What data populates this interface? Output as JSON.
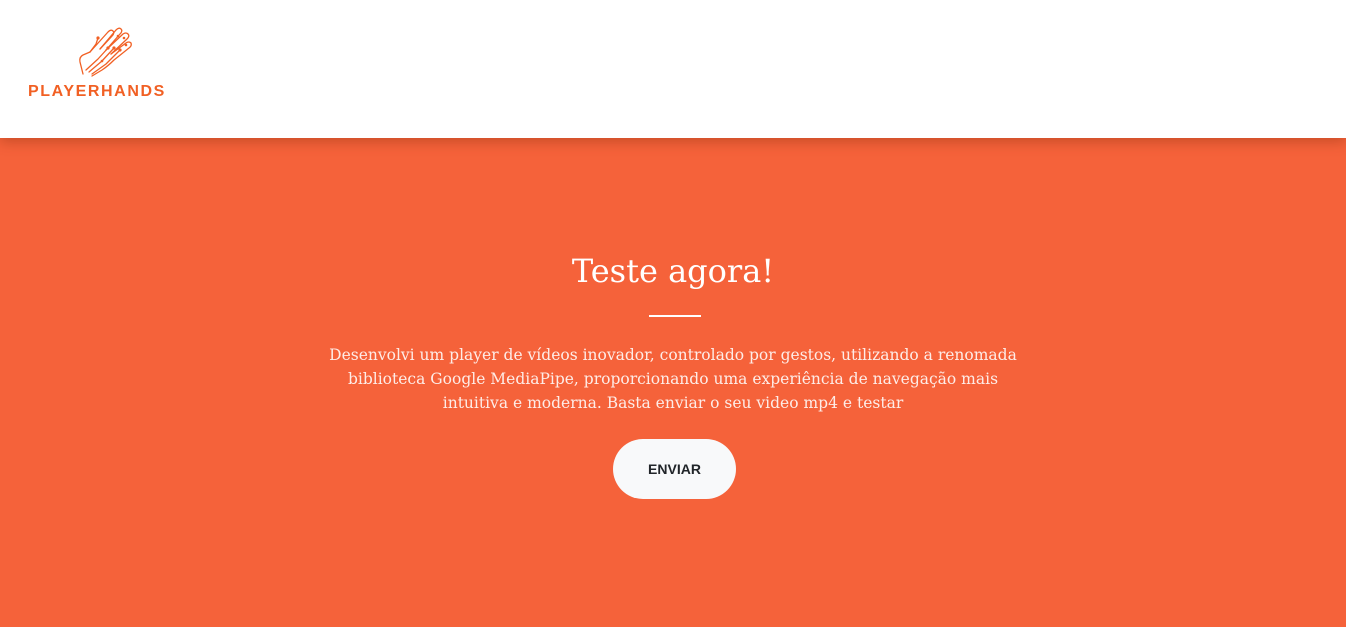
{
  "header": {
    "logo_text": "PLAYERHANDS",
    "logo_icon": "circuit-hand-icon"
  },
  "hero": {
    "title": "Teste agora!",
    "description": "Desenvolvi um player de vídeos inovador, controlado por gestos, utilizando a renomada biblioteca Google MediaPipe, proporcionando uma experiência de navegação mais intuitiva e moderna. Basta enviar o seu video mp4 e testar",
    "button_label": "ENVIAR"
  },
  "colors": {
    "brand_orange": "#f16024",
    "hero_background": "#f5623a",
    "button_background": "#f8f9fa"
  }
}
